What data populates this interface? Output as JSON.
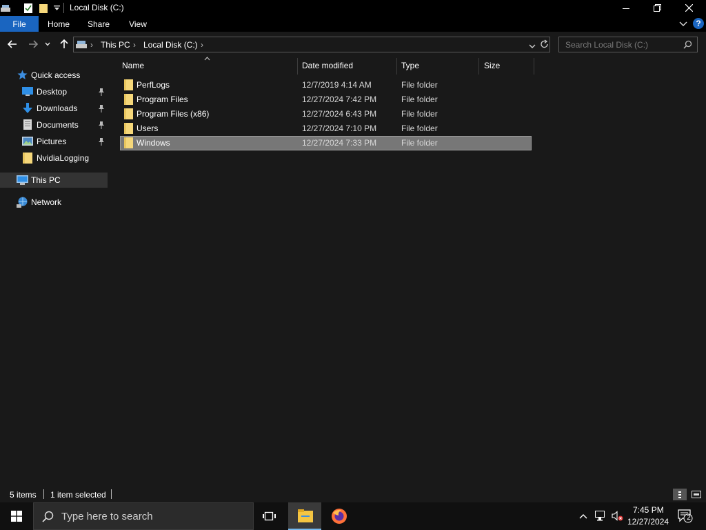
{
  "window": {
    "title": "Local Disk (C:)"
  },
  "ribbon": {
    "tabs": [
      {
        "label": "File"
      },
      {
        "label": "Home"
      },
      {
        "label": "Share"
      },
      {
        "label": "View"
      }
    ],
    "help_label": "?"
  },
  "address": {
    "breadcrumb": [
      "This PC",
      "Local Disk (C:)"
    ]
  },
  "search": {
    "placeholder": "Search Local Disk (C:)"
  },
  "sidebar": {
    "quick_access": "Quick access",
    "items": [
      {
        "label": "Desktop",
        "icon": "desktop-icon",
        "pinned": true
      },
      {
        "label": "Downloads",
        "icon": "download-arrow-icon",
        "pinned": true
      },
      {
        "label": "Documents",
        "icon": "documents-icon",
        "pinned": true
      },
      {
        "label": "Pictures",
        "icon": "pictures-icon",
        "pinned": true
      },
      {
        "label": "NvidiaLogging",
        "icon": "folder-icon",
        "pinned": false
      }
    ],
    "this_pc": "This PC",
    "network": "Network"
  },
  "list": {
    "columns": [
      "Name",
      "Date modified",
      "Type",
      "Size"
    ],
    "rows": [
      {
        "name": "PerfLogs",
        "date": "12/7/2019 4:14 AM",
        "type": "File folder",
        "size": ""
      },
      {
        "name": "Program Files",
        "date": "12/27/2024 7:42 PM",
        "type": "File folder",
        "size": ""
      },
      {
        "name": "Program Files (x86)",
        "date": "12/27/2024 6:43 PM",
        "type": "File folder",
        "size": ""
      },
      {
        "name": "Users",
        "date": "12/27/2024 7:10 PM",
        "type": "File folder",
        "size": ""
      },
      {
        "name": "Windows",
        "date": "12/27/2024 7:33 PM",
        "type": "File folder",
        "size": "",
        "selected": true
      }
    ]
  },
  "status": {
    "items_count": "5 items",
    "selected": "1 item selected"
  },
  "taskbar": {
    "search_placeholder": "Type here to search",
    "time": "7:45 PM",
    "date": "12/27/2024",
    "notification_count": "2"
  },
  "colors": {
    "accent": "#1a65c0",
    "background": "#191919",
    "selection": "#777777",
    "folder": "#f5d77a"
  }
}
